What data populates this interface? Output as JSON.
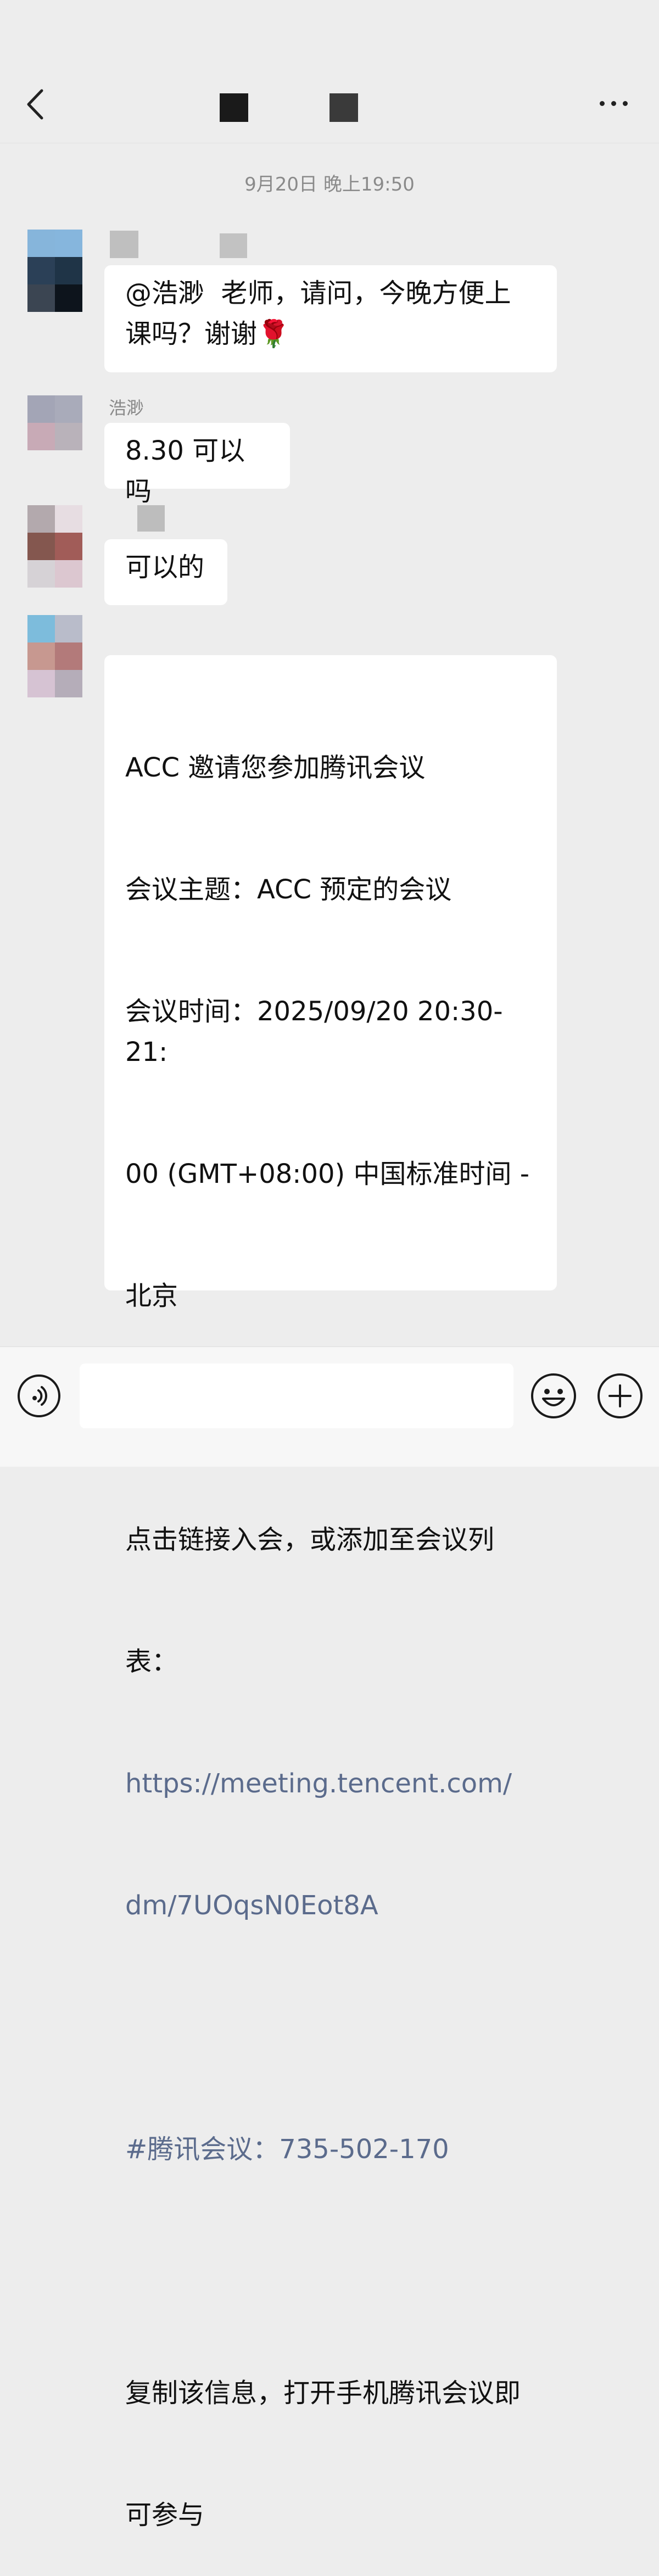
{
  "header": {
    "back_icon": "chevron-left-icon",
    "more_icon": "more-horizontal-icon"
  },
  "messages": {
    "timestamp": "9月20日 晚上19:50",
    "m1": {
      "text": "@浩渺  老师，请问，今晚方便上\n课吗？谢谢🌹"
    },
    "m2": {
      "sender": "浩渺",
      "text": "8.30 可以吗"
    },
    "m3": {
      "text": "可以的"
    },
    "m4": {
      "line1": "ACC 邀请您参加腾讯会议",
      "line2": "会议主题：ACC 预定的会议",
      "line3": "会议时间：2025/09/20 20:30-21:",
      "line4": "00 (GMT+08:00) 中国标准时间 -",
      "line5": "北京",
      "line6": "点击链接入会，或添加至会议列",
      "line7": "表：",
      "link1": "https://meeting.tencent.com/",
      "link2": "dm/7UOqsN0Eot8A",
      "meeting_id": "#腾讯会议：735-502-170",
      "line8": "复制该信息，打开手机腾讯会议即",
      "line9": "可参与"
    }
  },
  "bottom_bar": {
    "voice_icon": "voice-icon",
    "emoji_icon": "emoji-icon",
    "plus_icon": "plus-icon",
    "input_value": ""
  },
  "colors": {
    "background": "#ededed",
    "bubble": "#ffffff",
    "link": "#5b6b8c"
  }
}
